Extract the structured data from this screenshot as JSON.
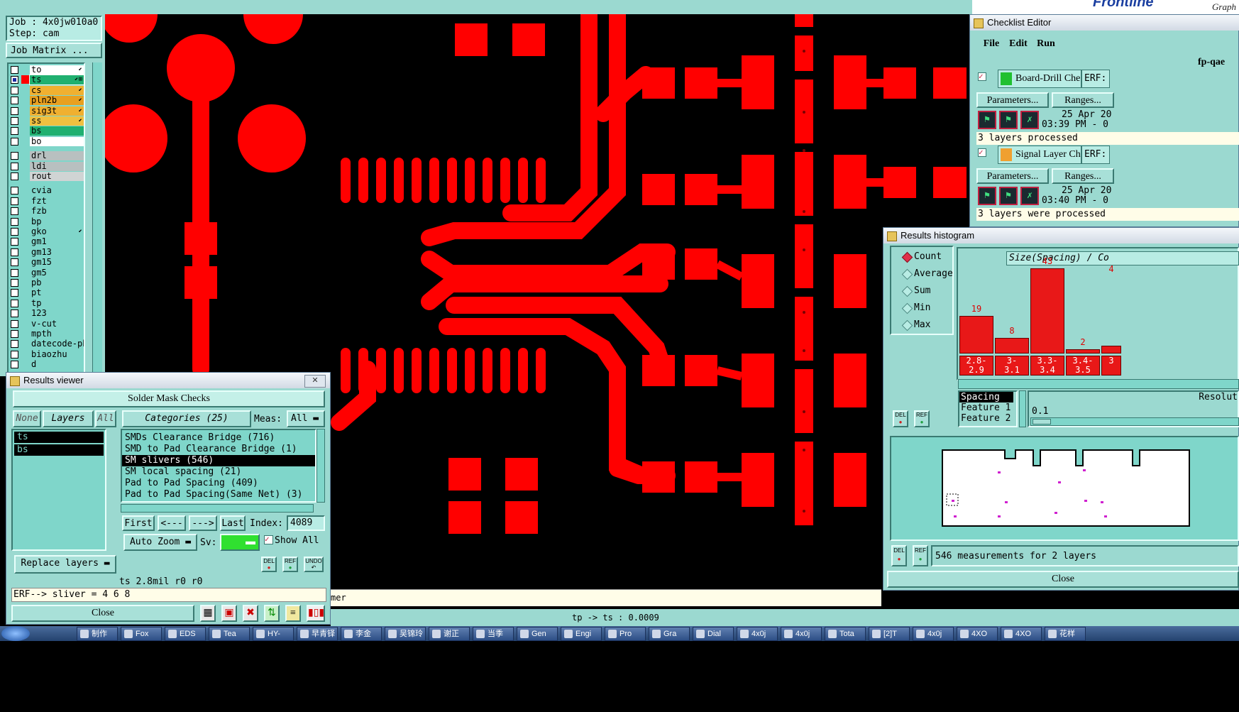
{
  "colors": {
    "panel": "#9bd9d0",
    "copper": "#ff0000",
    "canvas": "#000000",
    "selection": "#000000"
  },
  "top": {
    "brand": "Frontline",
    "graph_label": "Graph"
  },
  "job": {
    "job_label": "Job : 4x0jw010a0",
    "step_label": "Step: cam",
    "matrix_btn": "Job Matrix ..."
  },
  "layers": [
    {
      "name": "to",
      "bg": "#ffffff",
      "mark": "⬋"
    },
    {
      "name": "ts",
      "bg": "#20b070",
      "mark": "⬋⊞",
      "sel": true
    },
    {
      "name": "cs",
      "bg": "#f0b030",
      "mark": "⬋"
    },
    {
      "name": "pln2b",
      "bg": "#e8a020",
      "mark": "⬋"
    },
    {
      "name": "sig3t",
      "bg": "#f0b030",
      "mark": "⬋"
    },
    {
      "name": "ss",
      "bg": "#f0c040",
      "mark": "⬋"
    },
    {
      "name": "bs",
      "bg": "#20b070",
      "mark": ""
    },
    {
      "name": "bo",
      "bg": "#ffffff",
      "mark": ""
    },
    {
      "name": "drl",
      "bg": "#b8c0c0",
      "mark": ""
    },
    {
      "name": "ldi",
      "bg": "#b8c0c0",
      "mark": ""
    },
    {
      "name": "rout",
      "bg": "#d0d4d4",
      "mark": ""
    },
    {
      "name": "cvia",
      "bg": "#7fd6ca",
      "mark": ""
    },
    {
      "name": "fzt",
      "bg": "#7fd6ca",
      "mark": ""
    },
    {
      "name": "fzb",
      "bg": "#7fd6ca",
      "mark": ""
    },
    {
      "name": "bp",
      "bg": "#7fd6ca",
      "mark": ""
    },
    {
      "name": "gko",
      "bg": "#7fd6ca",
      "mark": "⬋"
    },
    {
      "name": "gm1",
      "bg": "#7fd6ca",
      "mark": ""
    },
    {
      "name": "gm13",
      "bg": "#7fd6ca",
      "mark": ""
    },
    {
      "name": "gm15",
      "bg": "#7fd6ca",
      "mark": ""
    },
    {
      "name": "gm5",
      "bg": "#7fd6ca",
      "mark": ""
    },
    {
      "name": "pb",
      "bg": "#7fd6ca",
      "mark": ""
    },
    {
      "name": "pt",
      "bg": "#7fd6ca",
      "mark": ""
    },
    {
      "name": "tp",
      "bg": "#7fd6ca",
      "mark": ""
    },
    {
      "name": "123",
      "bg": "#7fd6ca",
      "mark": ""
    },
    {
      "name": "v-cut",
      "bg": "#7fd6ca",
      "mark": ""
    },
    {
      "name": "mpth",
      "bg": "#7fd6ca",
      "mark": ""
    },
    {
      "name": "datecode-pbe",
      "bg": "#7fd6ca",
      "mark": ""
    },
    {
      "name": "biaozhu",
      "bg": "#7fd6ca",
      "mark": ""
    },
    {
      "name": "d",
      "bg": "#7fd6ca",
      "mark": ""
    }
  ],
  "results_viewer": {
    "title": "Results viewer",
    "header": "Solder Mask Checks",
    "none_btn": "None",
    "layers_btn": "Layers",
    "all_btn": "All",
    "categories_label": "Categories (25)",
    "meas_label": "Meas:",
    "meas_value": "All",
    "layer_items": [
      "ts",
      "bs"
    ],
    "categories": [
      "SMDs Clearance Bridge (716)",
      "SMD to Pad Clearance Bridge (1)",
      "SM slivers (546)",
      "SM local spacing (21)",
      "Pad to Pad Spacing (409)",
      "Pad to Pad Spacing(Same Net) (3)"
    ],
    "first_btn": "First",
    "prev_btn": "<---",
    "next_btn": "--->",
    "last_btn": "Last",
    "index_label": "Index:",
    "index_value": "4089",
    "zoom_value": "Auto Zoom",
    "sv_label": "Sv:",
    "show_all": "Show All",
    "replace_value": "Replace layers",
    "del": "DEL",
    "ref": "REF",
    "undo": "UNDO",
    "status": "ts 2.8mil   r0   r0",
    "erf": "ERF--> sliver = 4 6 8",
    "close_btn": "Close"
  },
  "canvas_status": {
    "message": "mer",
    "measure": "tp -> ts : 0.0009"
  },
  "checklist": {
    "title": "Checklist Editor",
    "menu": [
      "File",
      "Edit",
      "Run"
    ],
    "name": "fp-qae",
    "actions": [
      {
        "name": "Board-Drill Che",
        "erf": "ERF:",
        "params": "Parameters...",
        "ranges": "Ranges...",
        "date": "25 Apr 20",
        "time": "03:39 PM - 0",
        "status": "3 layers processed"
      },
      {
        "name": "Signal Layer Ch",
        "erf": "ERF:",
        "params": "Parameters...",
        "ranges": "Ranges...",
        "date": "25 Apr 20",
        "time": "03:40 PM - 0",
        "status": "3 layers were processed"
      }
    ]
  },
  "histogram": {
    "title": "Results histogram",
    "modes": [
      "Count",
      "Average",
      "Sum",
      "Min",
      "Max"
    ],
    "selected_mode": "Count",
    "chart_title": "Size(Spacing) / Co",
    "bars": [
      {
        "label": "2.8-\n2.9",
        "count": "19"
      },
      {
        "label": "3-\n3.1",
        "count": "8"
      },
      {
        "label": "3.3-\n3.4",
        "count": "43"
      },
      {
        "label": "3.4-\n3.5",
        "count": "2"
      },
      {
        "label": "3",
        "count": "4"
      }
    ],
    "axis_items": [
      "Spacing",
      "Feature 1",
      "Feature 2"
    ],
    "resolution_label": "Resolut",
    "resolution_value": "0.1",
    "del": "DEL",
    "ref": "REF",
    "summary": "546 measurements for 2 layers",
    "close_btn": "Close"
  },
  "taskbar": [
    "制作",
    "Fox",
    "EDS",
    "Tea",
    "HY-",
    "早青铎",
    "李金",
    "吴锦玲",
    "谢正",
    "当季",
    "Gen",
    "Engi",
    "Pro",
    "Gra",
    "Dial",
    "4x0j",
    "4x0j",
    "Tota",
    "[2]T",
    "4x0j",
    "4XO",
    "4XO",
    "花样"
  ]
}
